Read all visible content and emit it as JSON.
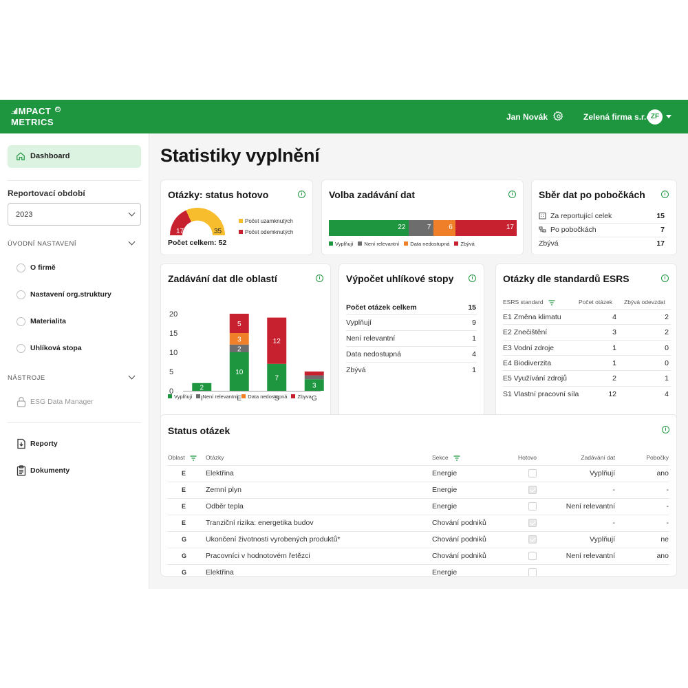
{
  "brand": {
    "line1": "IMPACT",
    "line2": "METRICS"
  },
  "header": {
    "user_name": "Jan Novák",
    "company": "Zelená firma s.r.o.",
    "avatar_initials": "ZF"
  },
  "sidebar": {
    "dashboard_label": "Dashboard",
    "period_label": "Reportovací období",
    "period_value": "2023",
    "section_setup": "ÚVODNÍ NASTAVENÍ",
    "setup_items": [
      "O firmě",
      "Nastavení org.struktury",
      "Materialita",
      "Uhlíková stopa"
    ],
    "section_tools": "NÁSTROJE",
    "tools_items": [
      "ESG Data Manager"
    ],
    "bottom_items": [
      "Reporty",
      "Dokumenty"
    ]
  },
  "page_title": "Statistiky vyplnění",
  "card_status_done": {
    "title": "Otázky: status hotovo",
    "locked_value": "35",
    "unlocked_value": "17",
    "legend_locked": "Počet uzamknutých",
    "legend_unlocked": "Počet odemknutých",
    "total_label": "Počet celkem:",
    "total_value": "52"
  },
  "card_input_choice": {
    "title": "Volba zadávání dat",
    "segments": [
      {
        "label": "Vyplňují",
        "value": 22,
        "color": "#1e9640"
      },
      {
        "label": "Není relevantní",
        "value": 7,
        "color": "#6d6d6d"
      },
      {
        "label": "Data nedostupná",
        "value": 6,
        "color": "#f07f2a"
      },
      {
        "label": "Zbývá",
        "value": 17,
        "color": "#c7202f"
      }
    ],
    "segment_texts": [
      "22",
      "7",
      "6",
      "17"
    ]
  },
  "card_branches": {
    "title": "Sběr dat po pobočkách",
    "rows": [
      {
        "label": "Za reportující celek",
        "value": "15"
      },
      {
        "label": "Po pobočkách",
        "value": "7"
      },
      {
        "label": "Zbývá",
        "value": "17"
      }
    ]
  },
  "card_areas": {
    "title": "Zadávání dat dle oblastí",
    "y_ticks": [
      "20",
      "15",
      "10",
      "5",
      "0"
    ],
    "legend": [
      "Vyplňují",
      "Není relevantní",
      "Data nedostupná",
      "Zbyva"
    ]
  },
  "chart_data": {
    "type": "bar",
    "stacked": true,
    "categories": [
      "I",
      "E",
      "S",
      "G"
    ],
    "ylim": [
      0,
      20
    ],
    "series": [
      {
        "name": "Vyplňují",
        "color": "#1e9640",
        "values": [
          2,
          10,
          7,
          3
        ]
      },
      {
        "name": "Není relevantní",
        "color": "#6d6d6d",
        "values": [
          0,
          2,
          0,
          1
        ]
      },
      {
        "name": "Data nedostupná",
        "color": "#f07f2a",
        "values": [
          0,
          3,
          0,
          0
        ]
      },
      {
        "name": "Zbyva",
        "color": "#c7202f",
        "values": [
          0,
          5,
          12,
          1
        ]
      }
    ]
  },
  "card_carbon": {
    "title": "Výpočet uhlíkové stopy",
    "total_label": "Počet otázek celkem",
    "total_value": "15",
    "rows": [
      {
        "label": "Vyplňují",
        "value": "9"
      },
      {
        "label": "Není relevantní",
        "value": "1"
      },
      {
        "label": "Data nedostupná",
        "value": "4"
      },
      {
        "label": "Zbývá",
        "value": "1"
      }
    ]
  },
  "card_esrs": {
    "title": "Otázky dle standardů ESRS",
    "columns": [
      "ESRS standard",
      "Počet otázek",
      "Zbývá odevzdat"
    ],
    "rows": [
      {
        "name": "E1 Změna klimatu",
        "count": "4",
        "left": "2"
      },
      {
        "name": "E2 Znečištění",
        "count": "3",
        "left": "2"
      },
      {
        "name": "E3 Vodní zdroje",
        "count": "1",
        "left": "0"
      },
      {
        "name": "E4 Biodiverzita",
        "count": "1",
        "left": "0"
      },
      {
        "name": "E5 Využívání zdrojů",
        "count": "2",
        "left": "1"
      },
      {
        "name": "S1 Vlastní pracovní síla",
        "count": "12",
        "left": "4"
      }
    ]
  },
  "card_question_status": {
    "title": "Status otázek",
    "columns": [
      "Oblast",
      "Otázky",
      "Sekce",
      "Hotovo",
      "Zadávání dat",
      "Pobočky"
    ],
    "rows": [
      {
        "area": "E",
        "question": "Elektřina",
        "section": "Energie",
        "done": false,
        "input": "Vyplňují",
        "branches": "ano"
      },
      {
        "area": "E",
        "question": "Zemní plyn",
        "section": "Energie",
        "done": true,
        "input": "-",
        "branches": "-"
      },
      {
        "area": "E",
        "question": "Odběr tepla",
        "section": "Energie",
        "done": false,
        "input": "Není relevantní",
        "branches": "-"
      },
      {
        "area": "E",
        "question": "Tranziční rizika: energetika budov",
        "section": "Chování podniků",
        "done": true,
        "input": "-",
        "branches": "-"
      },
      {
        "area": "G",
        "question": "Ukončení životnosti vyrobených produktů*",
        "section": "Chování podniků",
        "done": true,
        "input": "Vyplňují",
        "branches": "ne"
      },
      {
        "area": "G",
        "question": "Pracovníci v hodnotovém řetězci",
        "section": "Chování podniků",
        "done": false,
        "input": "Není relevantní",
        "branches": "ano"
      },
      {
        "area": "G",
        "question": "Elektřina",
        "section": "Energie",
        "done": false,
        "input": "",
        "branches": ""
      }
    ]
  }
}
